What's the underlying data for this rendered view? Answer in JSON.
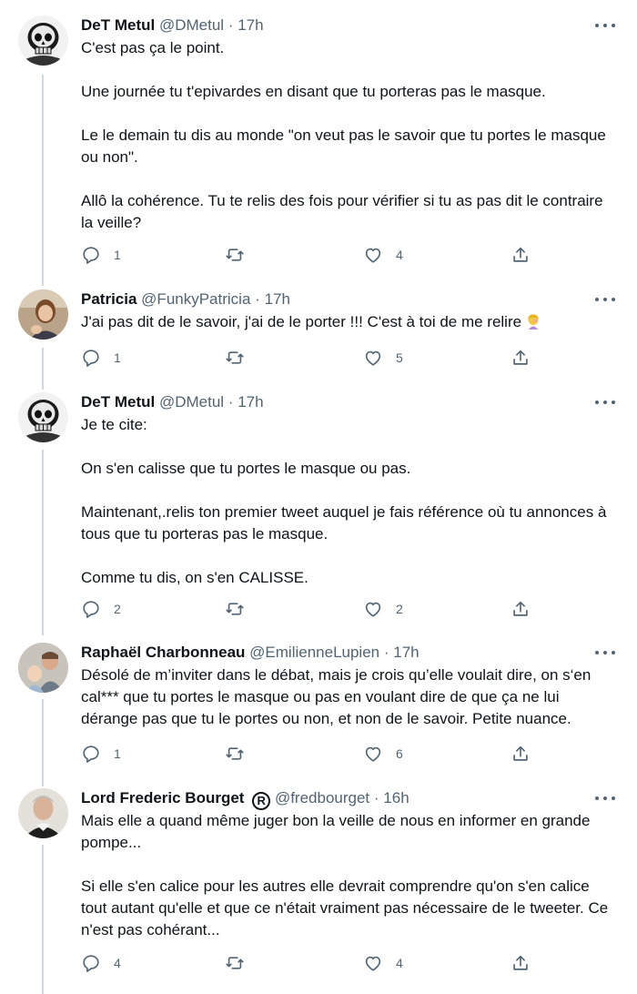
{
  "tweets": [
    {
      "name": "DeT Metul",
      "handle": "@DMetul",
      "dot": "·",
      "time": "17h",
      "paragraphs": [
        "C'est pas ça le point.",
        "Une journée tu t'epivardes en disant que tu porteras pas le masque.",
        "Le le demain tu dis au monde \"on veut pas le savoir que tu portes le masque ou non\".",
        "Allô la cohérence. Tu te relis des fois pour vérifier si tu as pas dit le contraire la veille?"
      ],
      "replies": "1",
      "retweets": "",
      "likes": "4",
      "avatar": "skull-avatar"
    },
    {
      "name": "Patricia",
      "handle": "@FunkyPatricia",
      "dot": "·",
      "time": "17h",
      "paragraphs": [
        "J'ai pas dit de le savoir, j'ai de le porter !!! C'est à toi de me relire"
      ],
      "emoji": "woman-facepalming-emoji",
      "replies": "1",
      "retweets": "",
      "likes": "5",
      "avatar": "photo-avatar"
    },
    {
      "name": "DeT Metul",
      "handle": "@DMetul",
      "dot": "·",
      "time": "17h",
      "paragraphs": [
        "Je te cite:",
        "On s'en calisse que tu portes le masque ou pas.",
        "Maintenant,.relis ton premier tweet auquel je fais référence où tu annonces à tous que tu porteras pas le masque.",
        "Comme tu dis, on s'en CALISSE."
      ],
      "replies": "2",
      "retweets": "",
      "likes": "2",
      "avatar": "skull-avatar"
    },
    {
      "name": "Raphaël Charbonneau",
      "handle": "@EmilienneLupien",
      "dot": "·",
      "time": "17h",
      "paragraphs": [
        "Désolé de m’inviter dans le débat, mais je crois qu’elle voulait dire, on s‘en cal*** que tu portes le masque ou pas en voulant dire de que ça ne lui dérange pas que tu le portes ou non, et non de le savoir. Petite nuance."
      ],
      "replies": "1",
      "retweets": "",
      "likes": "6",
      "avatar": "photo-avatar"
    },
    {
      "name": "Lord Frederic Bourget",
      "badge": "R",
      "handle": "@fredbourget",
      "dot": "·",
      "time": "16h",
      "paragraphs": [
        "Mais elle a quand même juger bon la veille de nous en informer en grande pompe...",
        "Si elle s'en calice pour les autres elle devrait comprendre qu'on s'en calice tout autant qu'elle et que ce n'était vraiment pas nécessaire de le tweeter. Ce n'est pas cohérant..."
      ],
      "replies": "4",
      "retweets": "",
      "likes": "4",
      "avatar": "photo-avatar"
    }
  ],
  "colors": {
    "text": "#0f1419",
    "secondary": "#536471",
    "thread_line": "#cfd9de"
  }
}
